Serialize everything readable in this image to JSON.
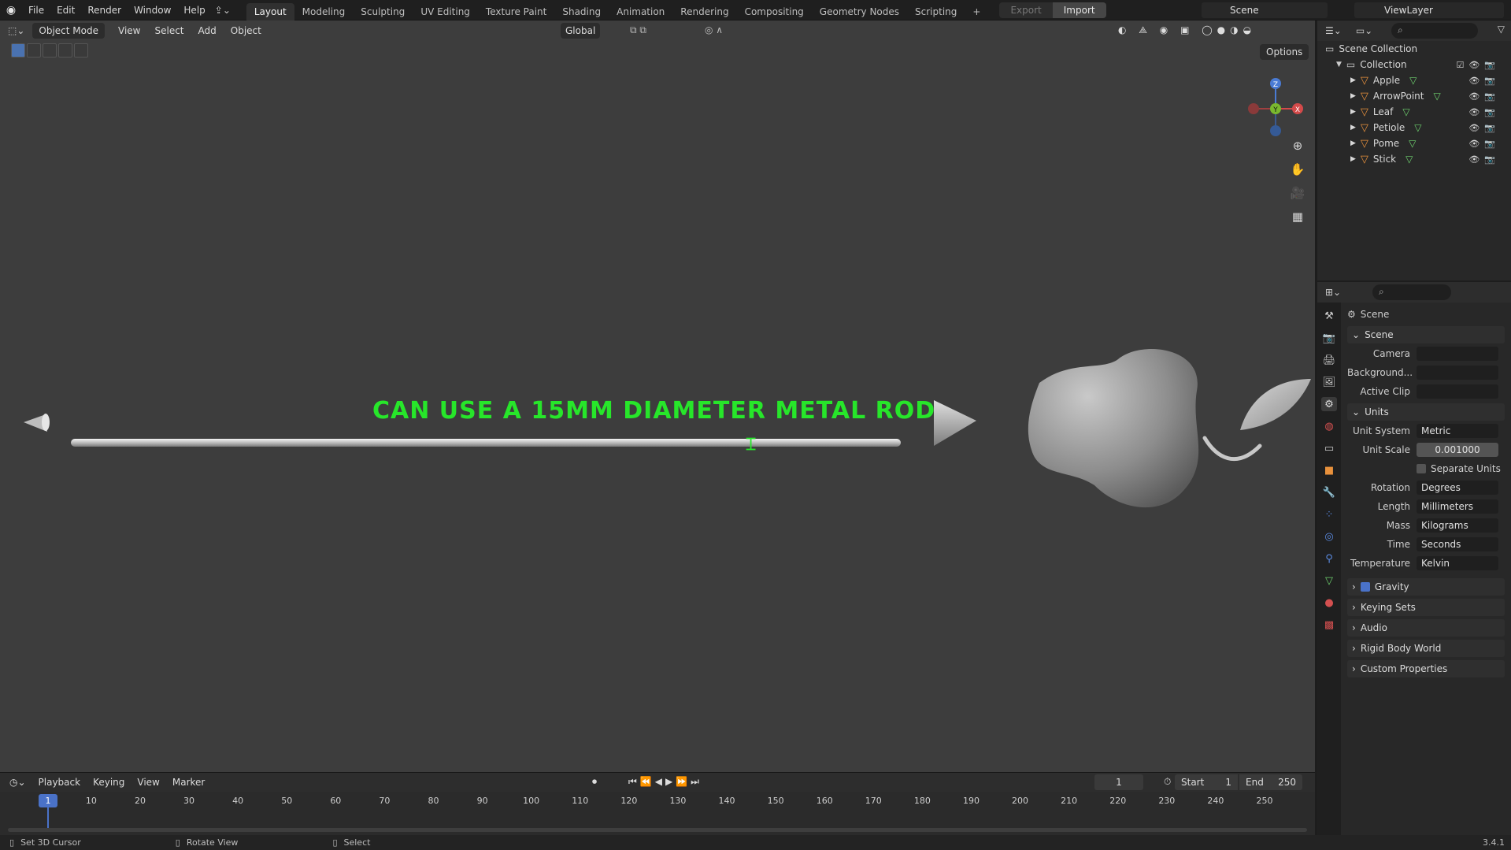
{
  "menu": [
    "File",
    "Edit",
    "Render",
    "Window",
    "Help"
  ],
  "tabs": [
    "Layout",
    "Modeling",
    "Sculpting",
    "UV Editing",
    "Texture Paint",
    "Shading",
    "Animation",
    "Rendering",
    "Compositing",
    "Geometry Nodes",
    "Scripting"
  ],
  "active_tab": "Layout",
  "export_label": "Export",
  "import_label": "Import",
  "scene_name": "Scene",
  "view_layer": "ViewLayer",
  "viewport": {
    "mode": "Object Mode",
    "menus": [
      "View",
      "Select",
      "Add",
      "Object"
    ],
    "orientation": "Global",
    "options_label": "Options",
    "annotation_text": "CAN USE A 15MM DIAMETER METAL ROD",
    "annotation_color": "#27e62a",
    "gizmo_labels": {
      "x": "X",
      "y": "Y",
      "z": "Z"
    }
  },
  "outliner": {
    "root": "Scene Collection",
    "collection": "Collection",
    "items": [
      "Apple",
      "ArrowPoint",
      "Leaf",
      "Petiole",
      "Pome",
      "Stick"
    ]
  },
  "properties": {
    "header": "Scene",
    "scene_panel": "Scene",
    "camera_label": "Camera",
    "background_label": "Background...",
    "active_clip_label": "Active Clip",
    "units_panel": "Units",
    "unit_system_label": "Unit System",
    "unit_system": "Metric",
    "unit_scale_label": "Unit Scale",
    "unit_scale": "0.001000",
    "separate_units": "Separate Units",
    "rotation_label": "Rotation",
    "rotation": "Degrees",
    "length_label": "Length",
    "length": "Millimeters",
    "mass_label": "Mass",
    "mass": "Kilograms",
    "time_label": "Time",
    "time": "Seconds",
    "temperature_label": "Temperature",
    "temperature": "Kelvin",
    "gravity": "Gravity",
    "keying_sets": "Keying Sets",
    "audio": "Audio",
    "rigid_body_world": "Rigid Body World",
    "custom_properties": "Custom Properties"
  },
  "timeline": {
    "menus": [
      "Playback",
      "Keying",
      "View",
      "Marker"
    ],
    "current_frame": "1",
    "start_label": "Start",
    "start": "1",
    "end_label": "End",
    "end": "250",
    "ticks": [
      "1",
      "10",
      "20",
      "30",
      "40",
      "50",
      "60",
      "70",
      "80",
      "90",
      "100",
      "110",
      "120",
      "130",
      "140",
      "150",
      "160",
      "170",
      "180",
      "190",
      "200",
      "210",
      "220",
      "230",
      "240",
      "250"
    ]
  },
  "status": {
    "left": "Set 3D Cursor",
    "middle": "Rotate View",
    "right": "Select",
    "version": "3.4.1"
  }
}
